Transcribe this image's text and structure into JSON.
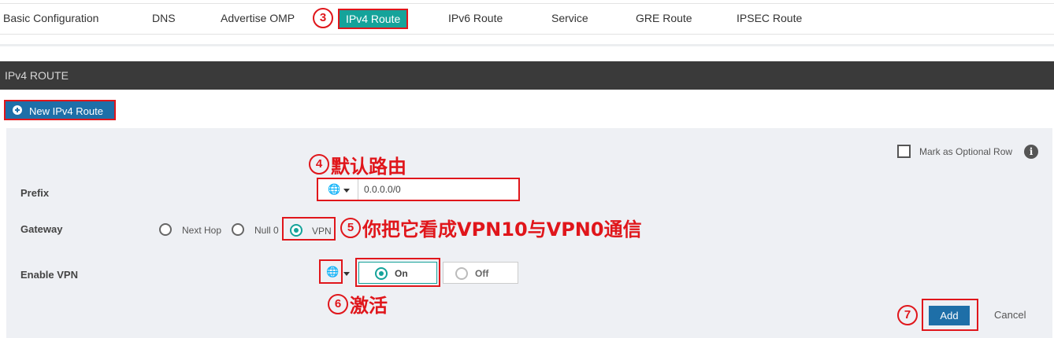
{
  "tabs": [
    {
      "label": "Basic Configuration"
    },
    {
      "label": "DNS"
    },
    {
      "label": "Advertise OMP"
    },
    {
      "label": "IPv4 Route"
    },
    {
      "label": "IPv6 Route"
    },
    {
      "label": "Service"
    },
    {
      "label": "GRE Route"
    },
    {
      "label": "IPSEC Route"
    }
  ],
  "active_tab": "IPv4 Route",
  "section": {
    "title": "IPv4 ROUTE"
  },
  "new_button": {
    "label": "New IPv4 Route",
    "icon": "plus-circle-icon"
  },
  "optional_row": {
    "label": "Mark as Optional Row",
    "checked": false,
    "info_icon": "info-icon",
    "info_glyph": "i"
  },
  "prefix": {
    "label": "Prefix",
    "value": "0.0.0.0/0",
    "scope_icon": "globe-icon"
  },
  "gateway": {
    "label": "Gateway",
    "options": [
      "Next Hop",
      "Null 0",
      "VPN"
    ],
    "selected": "VPN"
  },
  "enable_vpn": {
    "label": "Enable VPN",
    "scope_icon": "globe-icon",
    "on_label": "On",
    "off_label": "Off",
    "selected": "On"
  },
  "actions": {
    "add_label": "Add",
    "cancel_label": "Cancel"
  },
  "annotations": {
    "n3": "3",
    "n4": "4",
    "a4": "默认路由",
    "n5": "5",
    "a5": "你把它看成VPN10与VPN0通信",
    "n6": "6",
    "a6": "激活",
    "n7": "7"
  },
  "colors": {
    "accent": "#15a39a",
    "primary_button": "#1e6fa8",
    "header_bar": "#3a3a3a",
    "annotation_red": "#e0161b"
  }
}
